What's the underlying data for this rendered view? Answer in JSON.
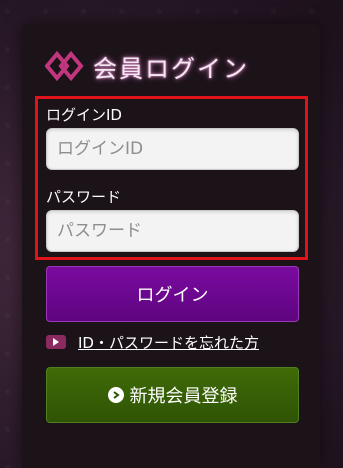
{
  "header": {
    "title": "会員ログイン",
    "icon": "double-diamond-icon",
    "icon_color": "#c2367e"
  },
  "form": {
    "id_label": "ログインID",
    "id_placeholder": "ログインID",
    "id_value": "",
    "password_label": "パスワード",
    "password_placeholder": "パスワード",
    "password_value": ""
  },
  "actions": {
    "login_label": "ログイン",
    "forgot_label": "ID・パスワードを忘れた方",
    "register_label": "新規会員登録"
  },
  "colors": {
    "login_button": "#6c0890",
    "register_button": "#376006",
    "highlight_frame": "#e0121a",
    "forgot_arrow_bg": "#8b2a60"
  }
}
